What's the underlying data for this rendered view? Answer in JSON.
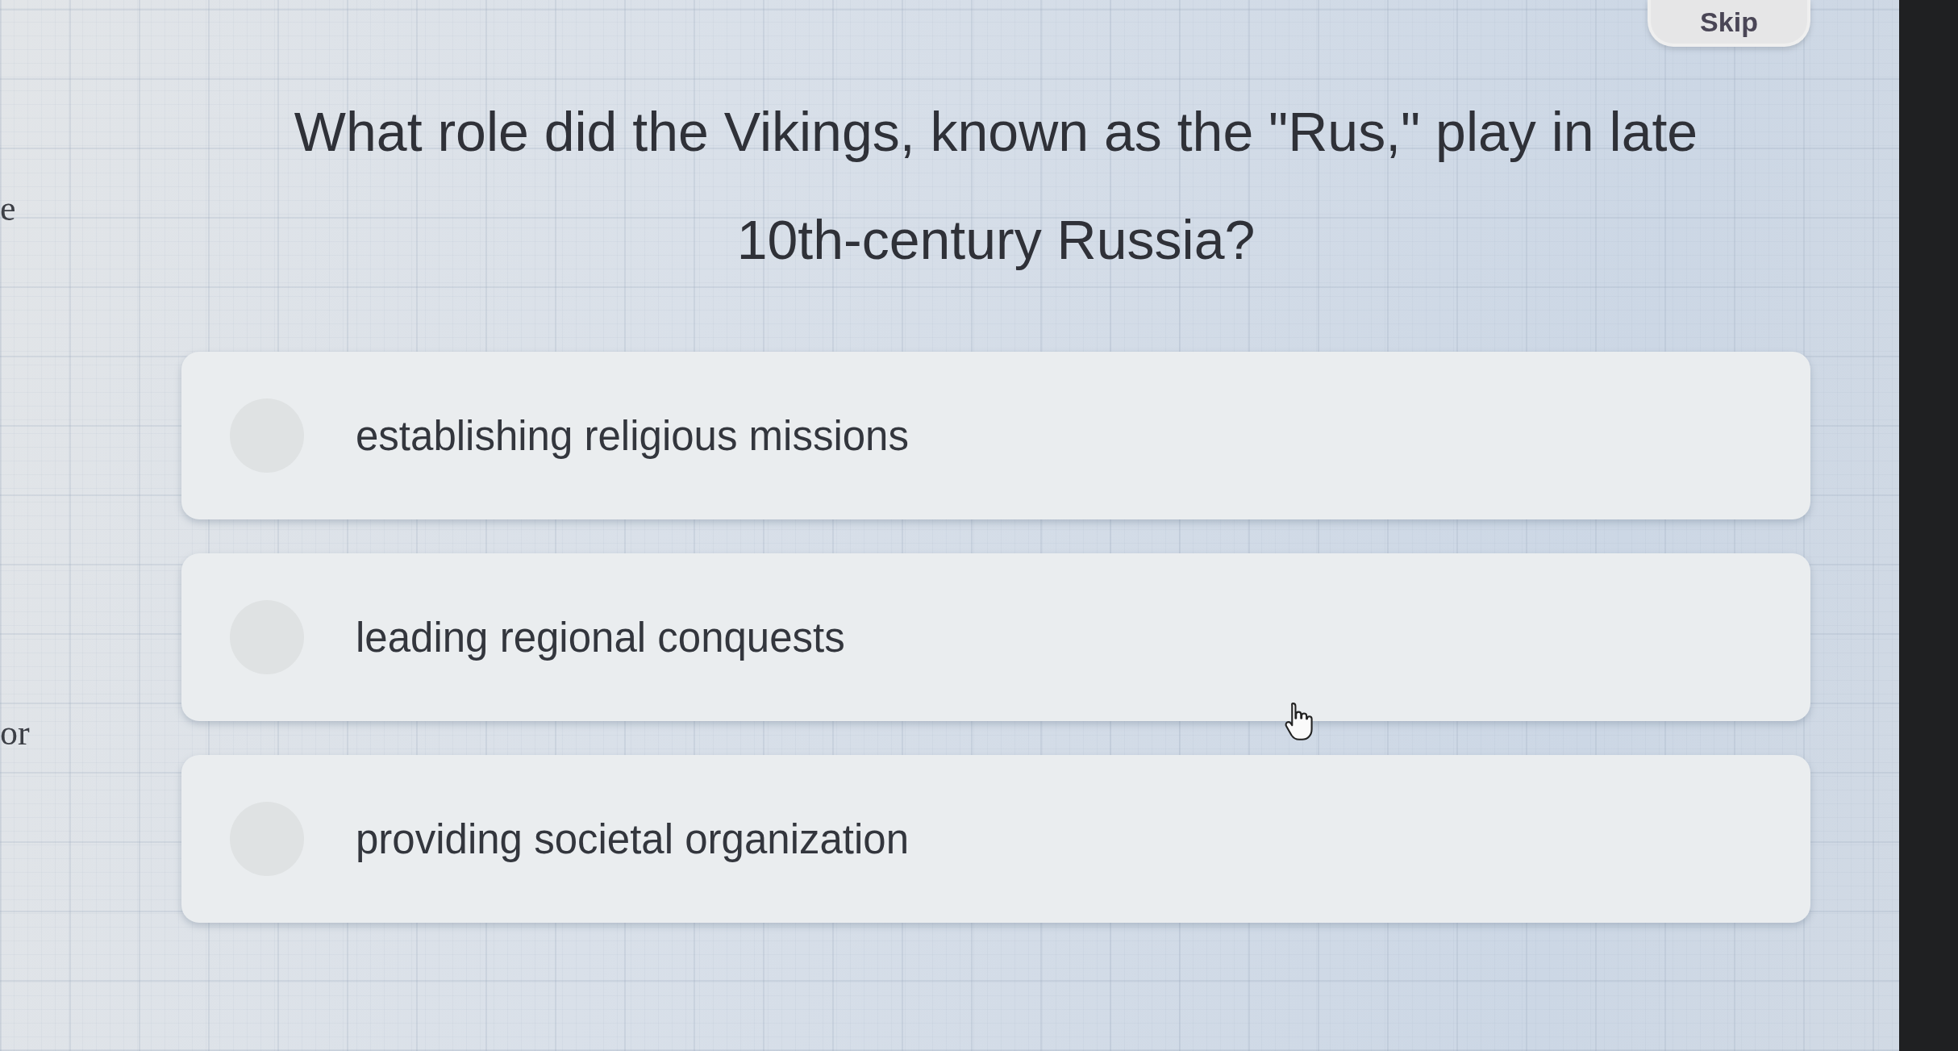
{
  "skip_button": {
    "label": "Skip"
  },
  "question": {
    "text": "What role did the Vikings, known as the \"Rus,\" play in late 10th-century Russia?"
  },
  "options": [
    {
      "label": "establishing religious missions",
      "selected": false
    },
    {
      "label": "leading regional conquests",
      "selected": false
    },
    {
      "label": "providing societal organization",
      "selected": false
    }
  ],
  "side_fragments": [
    "e",
    "or"
  ]
}
